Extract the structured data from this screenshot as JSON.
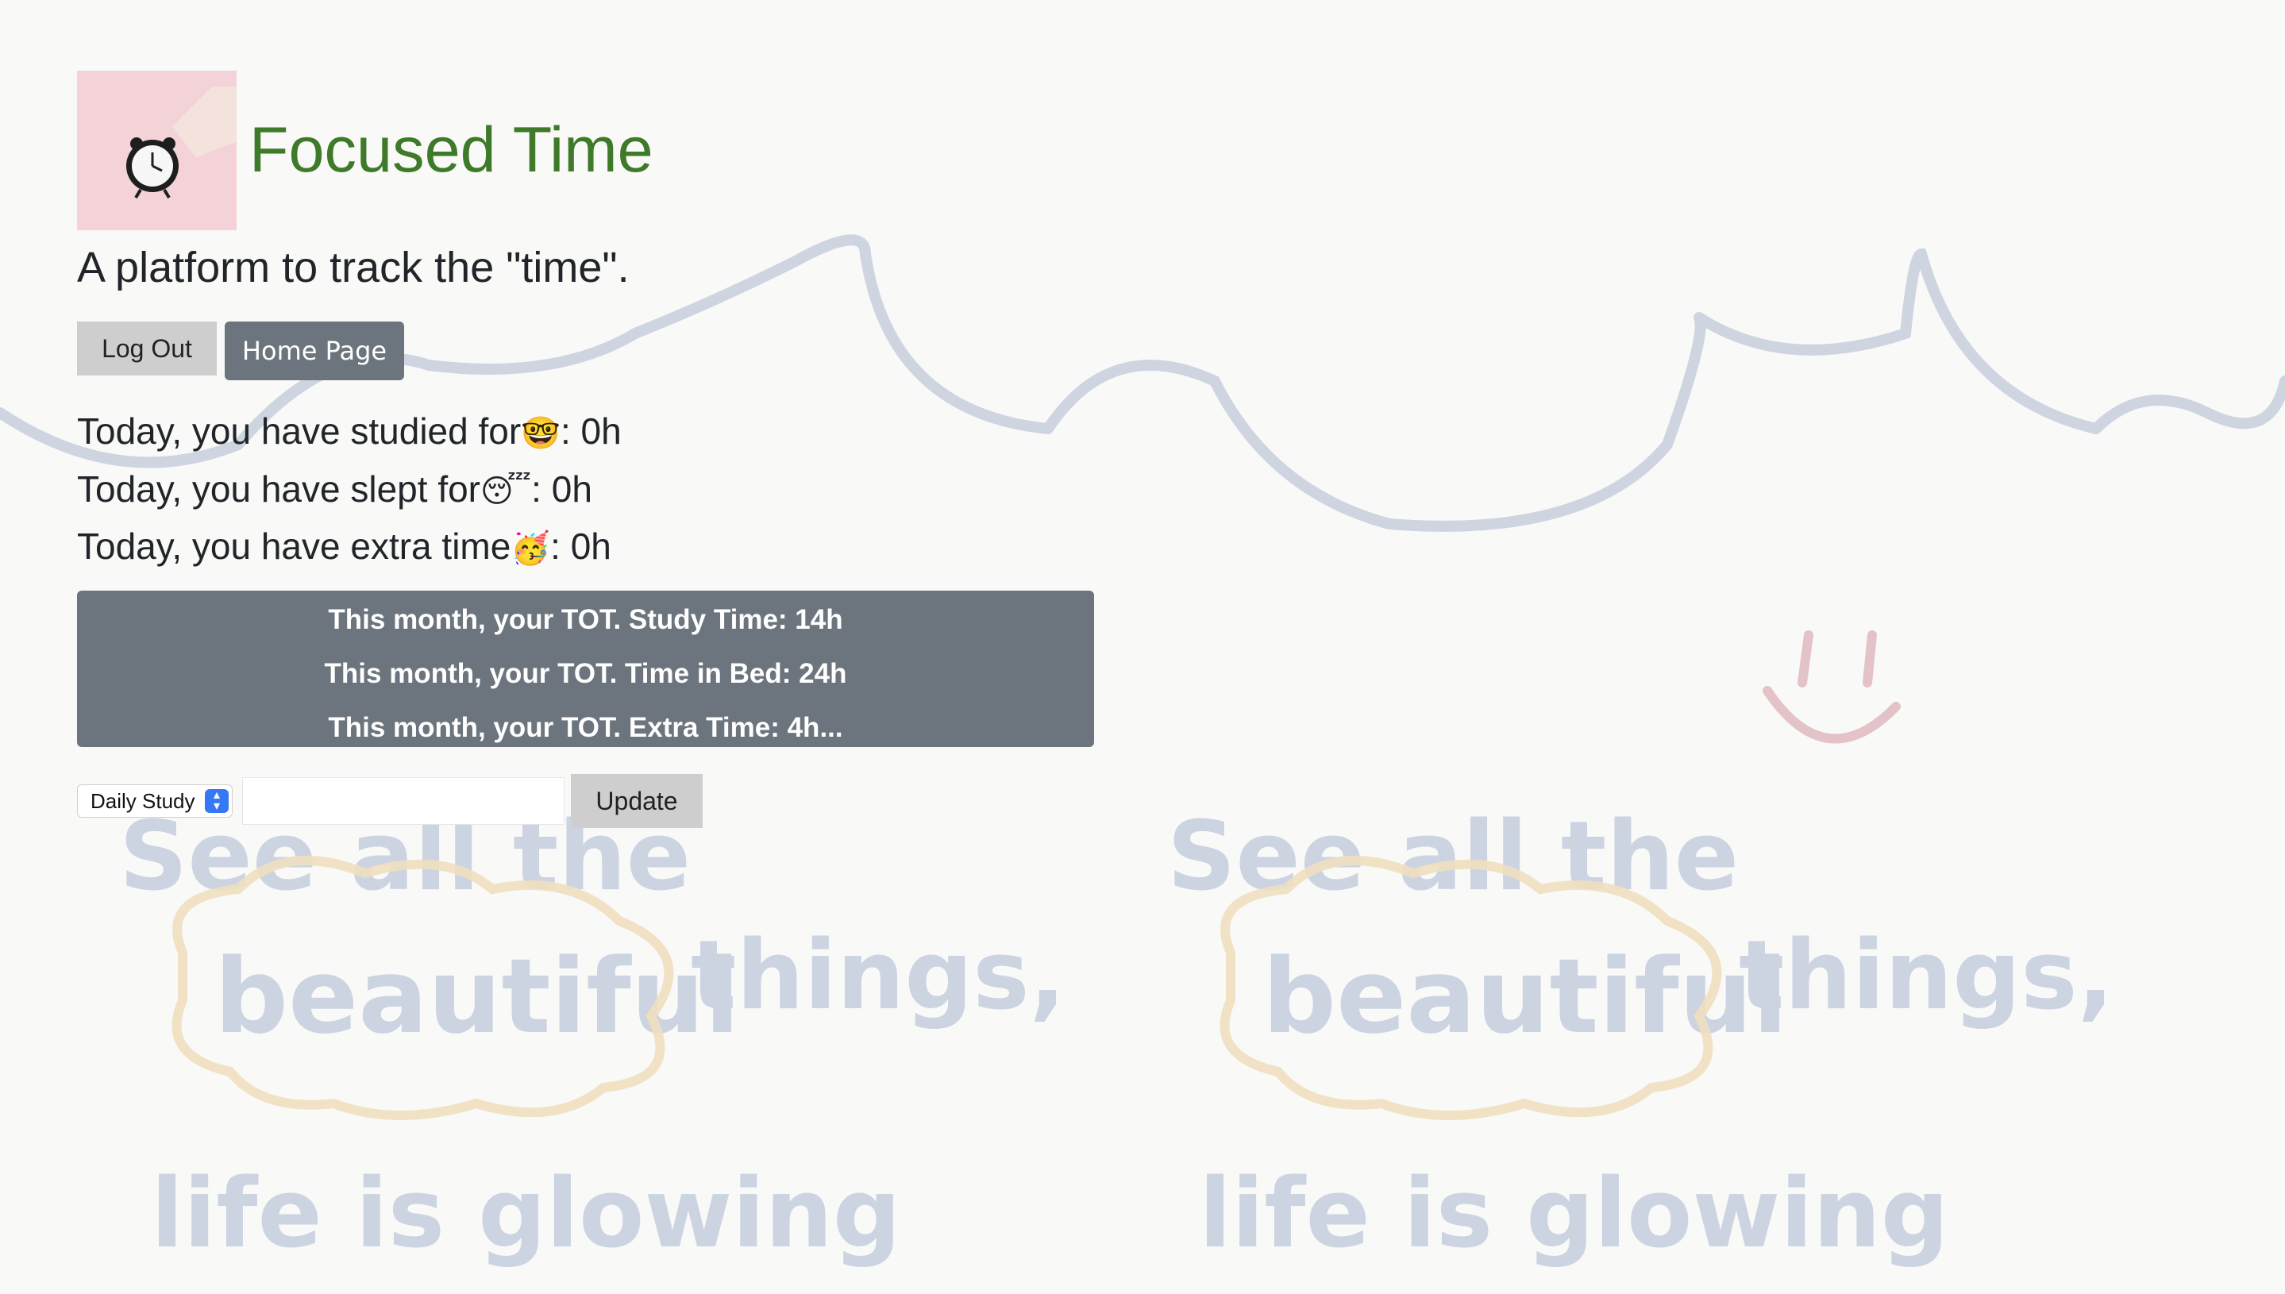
{
  "header": {
    "title": "Focused Time",
    "tagline": "A platform to track the \"time\"."
  },
  "buttons": {
    "logout": "Log Out",
    "home": "Home Page"
  },
  "today": {
    "studied": {
      "label": "Today, you have studied for",
      "emoji": "🤓",
      "value": ": 0h"
    },
    "slept": {
      "label": "Today, you have slept for",
      "emoji": "😴",
      "value": ": 0h"
    },
    "extra": {
      "label": "Today, you have extra time",
      "emoji": "🥳",
      "value": ": 0h"
    }
  },
  "month": {
    "study": "This month, your TOT. Study Time: 14h",
    "bed": "This month, your TOT. Time in Bed: 24h",
    "extra": "This month, your TOT. Extra Time: 4h..."
  },
  "form": {
    "selected": "Daily Study",
    "input_value": "",
    "update_label": "Update"
  },
  "background": {
    "phrase_line1": "See all the",
    "phrase_word": "beautiful",
    "phrase_line2": "things,",
    "phrase_line3": "life is glowing"
  },
  "colors": {
    "title": "#3f7a2a",
    "box": "#6c757d",
    "grey_button": "#cecece",
    "select_accent": "#3478f6"
  }
}
